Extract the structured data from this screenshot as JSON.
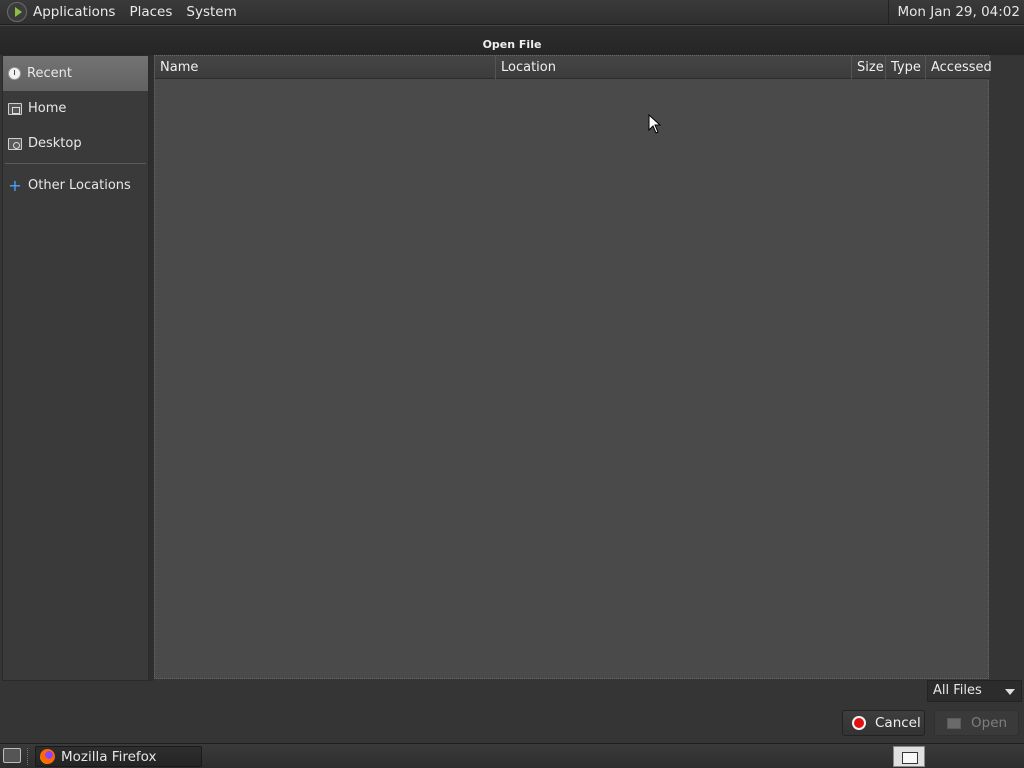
{
  "top_panel": {
    "menus": [
      "Applications",
      "Places",
      "System"
    ],
    "clock": "Mon Jan 29, 04:02"
  },
  "dialog": {
    "title": "Open File",
    "sidebar": {
      "items": [
        {
          "label": "Recent",
          "icon": "recent-icon",
          "selected": true
        },
        {
          "label": "Home",
          "icon": "home-folder-icon",
          "selected": false
        },
        {
          "label": "Desktop",
          "icon": "desktop-folder-icon",
          "selected": false
        }
      ],
      "other_locations": {
        "label": "Other Locations",
        "icon": "plus-icon"
      }
    },
    "columns": [
      "Name",
      "Location",
      "Size",
      "Type",
      "Accessed"
    ],
    "filter": {
      "selected": "All Files"
    },
    "buttons": {
      "cancel": "Cancel",
      "open": "Open"
    }
  },
  "taskbar": {
    "task": "Mozilla Firefox"
  },
  "colors": {
    "accent_plus": "#4aa3ff",
    "cancel_red": "#e11010",
    "selected_row": "#6b6b6b"
  }
}
